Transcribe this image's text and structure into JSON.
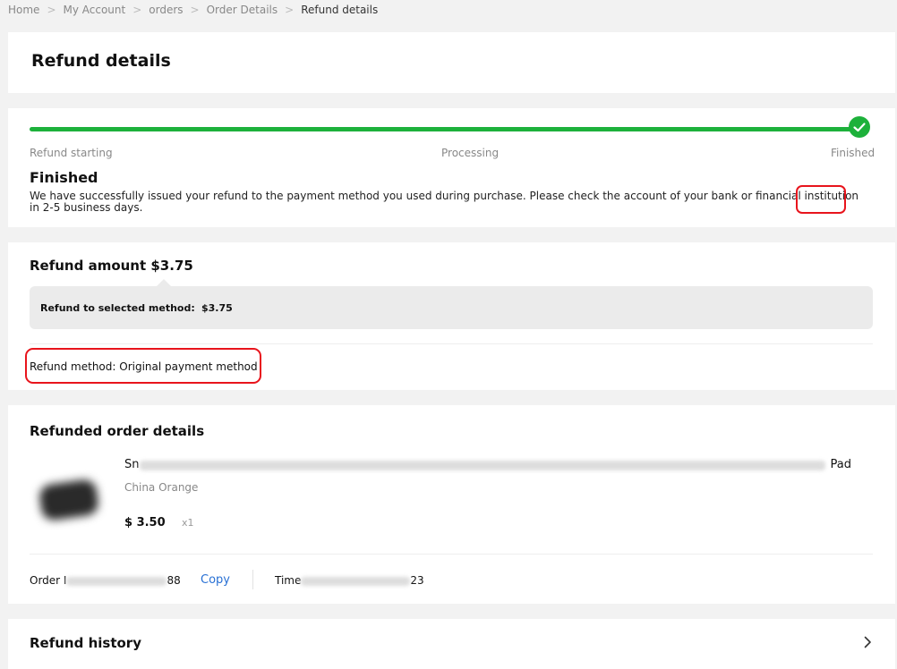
{
  "breadcrumb": {
    "items": [
      "Home",
      "My Account",
      "orders",
      "Order Details"
    ],
    "separator": ">",
    "current": "Refund details"
  },
  "page": {
    "title": "Refund details"
  },
  "progress": {
    "steps": [
      "Refund starting",
      "Processing",
      "Finished"
    ],
    "completed_fraction": 1.0,
    "status_title": "Finished",
    "status_description": "We have successfully issued your refund to the payment method you used during purchase. Please check the account of your bank or financial institution in 2-5 business days.",
    "accent_color": "#1db13b"
  },
  "refund": {
    "title": "Refund amount $3.75",
    "selected_method_label": "Refund to selected method:",
    "selected_method_value": "$3.75",
    "method_text": "Refund method: Original payment method"
  },
  "order": {
    "title": "Refunded order details",
    "product_name_start": "Sn",
    "product_name_end": "Pad",
    "variant": "China Orange",
    "price": "$ 3.50",
    "quantity": "x1",
    "order_label": "Order I",
    "order_suffix": "88",
    "copy_label": "Copy",
    "time_label": "Time",
    "time_suffix": "23"
  },
  "history": {
    "title": "Refund history"
  },
  "colors": {
    "highlight": "#e8141c",
    "link": "#2870d4"
  }
}
